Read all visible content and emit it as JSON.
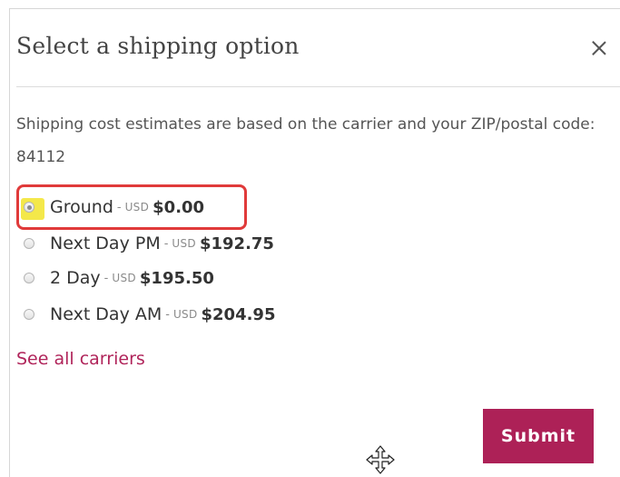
{
  "dialog": {
    "title": "Select a shipping option",
    "description": "Shipping cost estimates are based on the carrier and your ZIP/postal code: 84112"
  },
  "options": [
    {
      "name": "Ground",
      "separator": "-",
      "currency": "USD",
      "price": "$0.00",
      "selected": true
    },
    {
      "name": "Next Day PM",
      "separator": "-",
      "currency": "USD",
      "price": "$192.75",
      "selected": false
    },
    {
      "name": "2 Day",
      "separator": "-",
      "currency": "USD",
      "price": "$195.50",
      "selected": false
    },
    {
      "name": "Next Day AM",
      "separator": "-",
      "currency": "USD",
      "price": "$204.95",
      "selected": false
    }
  ],
  "links": {
    "see_all_carriers": "See all carriers"
  },
  "actions": {
    "submit_label": "Submit"
  },
  "colors": {
    "accent": "#ad2157",
    "link": "#b0245a",
    "annotation_box": "#e03a3a",
    "annotation_highlight": "#f4e84a"
  },
  "icons": {
    "close": "close-icon",
    "cursor": "move-cursor-icon"
  }
}
